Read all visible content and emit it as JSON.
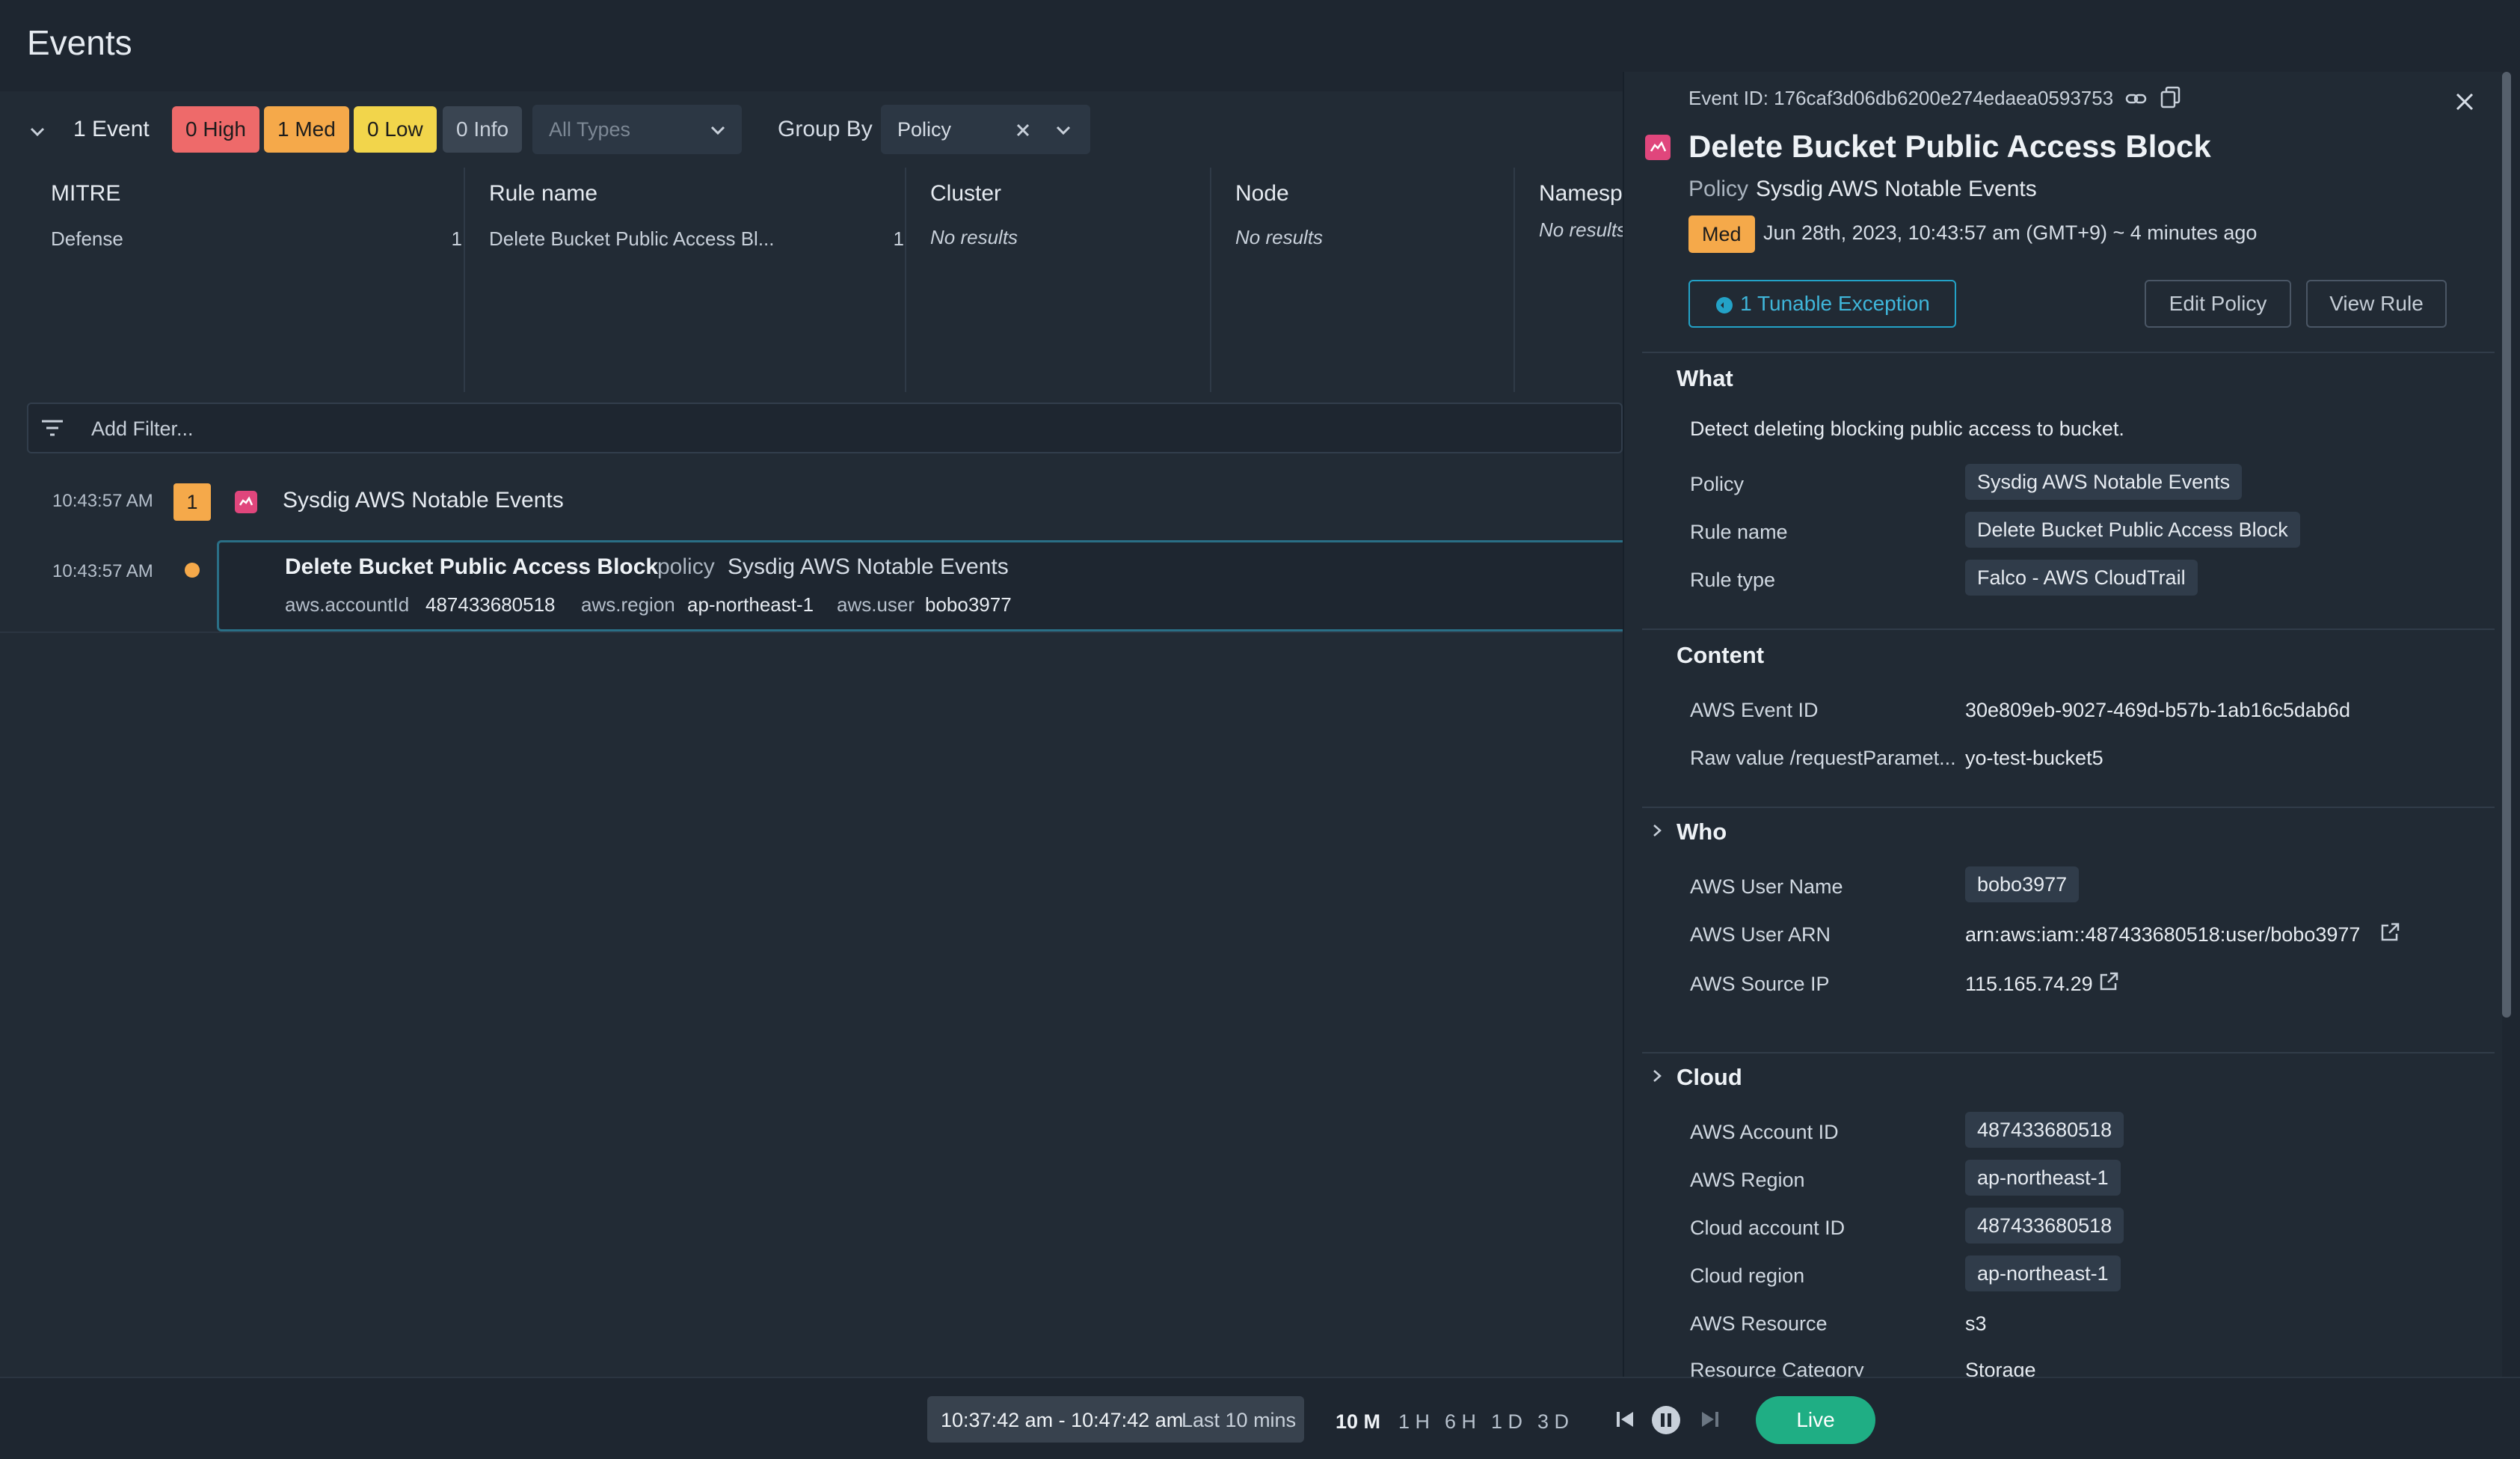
{
  "page": {
    "title": "Events"
  },
  "summary": {
    "event_count": "1 Event",
    "severity": {
      "high": "0 High",
      "med": "1 Med",
      "low": "0 Low",
      "info": "0 Info"
    },
    "type_filter_placeholder": "All Types",
    "group_by_label": "Group By",
    "group_by_value": "Policy"
  },
  "group_columns": [
    {
      "title": "MITRE",
      "items": [
        {
          "label": "Defense",
          "count": "1"
        }
      ],
      "empty": ""
    },
    {
      "title": "Rule name",
      "items": [
        {
          "label": "Delete Bucket Public Access Bl...",
          "count": "1"
        }
      ],
      "empty": ""
    },
    {
      "title": "Cluster",
      "items": [],
      "empty": "No results"
    },
    {
      "title": "Node",
      "items": [],
      "empty": "No results"
    },
    {
      "title": "Namesp",
      "items": [],
      "empty": "No results"
    }
  ],
  "filter": {
    "placeholder": "Add Filter..."
  },
  "event_group": {
    "time": "10:43:57 AM",
    "count": "1",
    "title": "Sysdig AWS Notable Events"
  },
  "event_item": {
    "time": "10:43:57 AM",
    "title": "Delete Bucket Public Access Block",
    "policy_label": "policy",
    "policy_value": "Sysdig AWS Notable Events",
    "fields": [
      {
        "key": "aws.accountId",
        "value": "487433680518"
      },
      {
        "key": "aws.region",
        "value": "ap-northeast-1"
      },
      {
        "key": "aws.user",
        "value": "bobo3977"
      }
    ]
  },
  "drawer": {
    "event_id": "Event ID: 176caf3d06db6200e274edaea0593753",
    "title": "Delete Bucket Public Access Block",
    "policy_label": "Policy",
    "policy_value": "Sysdig AWS Notable Events",
    "severity": "Med",
    "timestamp": "Jun 28th, 2023, 10:43:57 am (GMT+9) ~ 4 minutes ago",
    "tunable_btn": "1 Tunable Exception",
    "edit_policy_btn": "Edit Policy",
    "view_rule_btn": "View Rule",
    "what": {
      "title": "What",
      "description": "Detect deleting blocking public access to bucket.",
      "rows": [
        {
          "label": "Policy",
          "value": "Sysdig AWS Notable Events"
        },
        {
          "label": "Rule name",
          "value": "Delete Bucket Public Access Block"
        },
        {
          "label": "Rule type",
          "value": "Falco - AWS CloudTrail"
        }
      ]
    },
    "content": {
      "title": "Content",
      "rows": [
        {
          "label": "AWS Event ID",
          "value": "30e809eb-9027-469d-b57b-1ab16c5dab6d"
        },
        {
          "label": "Raw value /requestParamet...",
          "value": "yo-test-bucket5"
        }
      ]
    },
    "who": {
      "title": "Who",
      "rows": [
        {
          "label": "AWS User Name",
          "value": "bobo3977"
        },
        {
          "label": "AWS User ARN",
          "value": "arn:aws:iam::487433680518:user/bobo3977"
        },
        {
          "label": "AWS Source IP",
          "value": "115.165.74.29"
        }
      ]
    },
    "cloud": {
      "title": "Cloud",
      "rows": [
        {
          "label": "AWS Account ID",
          "value": "487433680518"
        },
        {
          "label": "AWS Region",
          "value": "ap-northeast-1"
        },
        {
          "label": "Cloud account ID",
          "value": "487433680518"
        },
        {
          "label": "Cloud region",
          "value": "ap-northeast-1"
        },
        {
          "label": "AWS Resource",
          "value": "s3"
        },
        {
          "label": "Resource Category",
          "value": "Storage"
        }
      ]
    }
  },
  "timebar": {
    "range": "10:37:42 am - 10:47:42 am",
    "range_label": "Last 10 mins",
    "options": [
      "10 M",
      "1 H",
      "6 H",
      "1 D",
      "3 D"
    ],
    "live_label": "Live"
  },
  "colors": {
    "high": "#ee6a6a",
    "med": "#f5a94a",
    "low": "#f2d54b",
    "info": "#3a4552",
    "accent": "#23a2c7",
    "live": "#1fae84",
    "policy_icon": "#e0467c"
  }
}
